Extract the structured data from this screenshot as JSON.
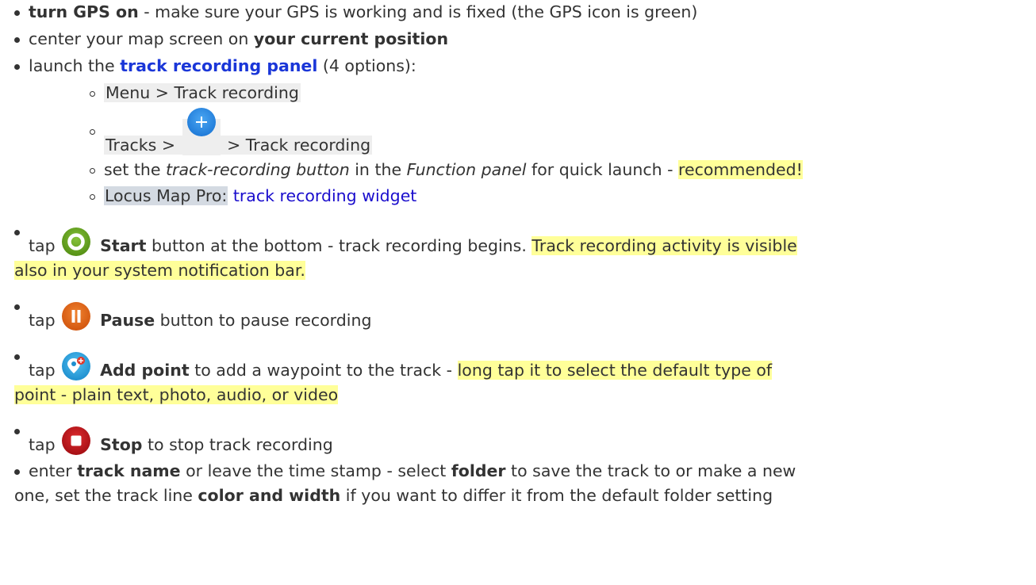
{
  "items": {
    "gps": {
      "bold": "turn GPS on",
      "rest": " - make sure your GPS is working and is fixed (the GPS icon is green)"
    },
    "center": {
      "pre": "center your map screen on ",
      "bold": "your current position"
    },
    "launch": {
      "pre": "launch the ",
      "link": "track recording panel",
      "post": " (4 options):",
      "sub": {
        "menu": "Menu > Track recording",
        "tracks_pre": "Tracks > ",
        "tracks_post": " > Track recording",
        "set_pre": "set the ",
        "set_i1": "track-recording button",
        "set_mid": " in the ",
        "set_i2": "Function panel",
        "set_post": " for quick launch - ",
        "set_hl": "recommended!",
        "pro_label": "Locus Map Pro:",
        "pro_link": "track recording widget"
      }
    },
    "start": {
      "tap": "tap ",
      "bold": "Start",
      "rest": " button at the bottom - track recording begins. ",
      "hl1": "Track recording activity is visible",
      "hl2": "also in your system notification bar."
    },
    "pause": {
      "tap": "tap ",
      "bold": "Pause",
      "rest": " button to pause recording"
    },
    "addpoint": {
      "tap": "tap ",
      "bold": "Add point",
      "rest": " to add a waypoint to the track - ",
      "hl1": "long tap it to select the default type of",
      "hl2": "point - plain text, photo, audio, or video"
    },
    "stop": {
      "tap": "tap ",
      "bold": "Stop",
      "rest": " to stop track recording"
    },
    "enter": {
      "t1": "enter ",
      "b1": "track name",
      "t2": " or leave the time stamp - select ",
      "b2": "folder",
      "t3": " to save the track to or make a new",
      "t4": "one, set the track line ",
      "b3": "color and width",
      "t5": " if you want to differ it from the default folder setting"
    }
  },
  "icons": {
    "plus": "plus-circle-icon",
    "start": "record-start-icon",
    "pause": "record-pause-icon",
    "addpoint": "add-point-icon",
    "stop": "record-stop-icon"
  },
  "colors": {
    "text": "#333333",
    "link": "#1a0dcd",
    "highlight": "#ffff99",
    "start_icon": "#6aa324",
    "pause_icon": "#e2661c",
    "addpoint_icon": "#2aa8e0",
    "stop_icon": "#c4161c",
    "plus_icon": "#2c8ae6"
  }
}
